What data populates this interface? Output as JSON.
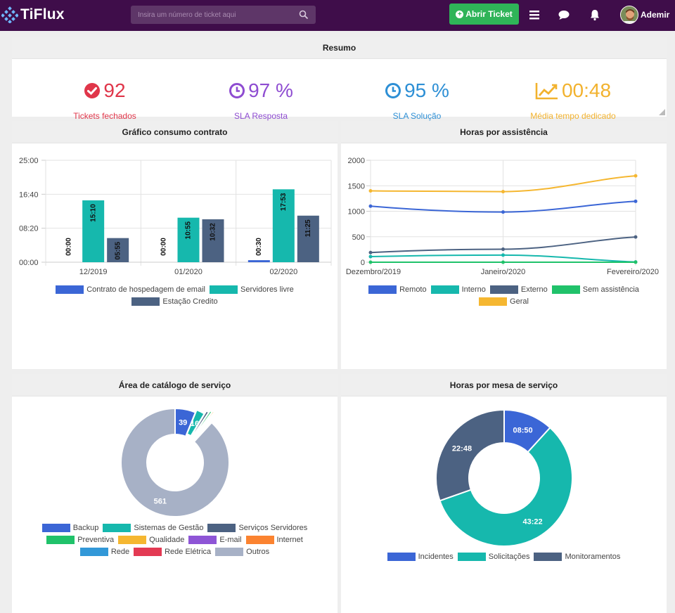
{
  "app": {
    "name": "TiFlux"
  },
  "search": {
    "placeholder": "Insira um número de ticket aqui"
  },
  "toolbar": {
    "new_ticket_label": "Abrir Ticket",
    "user_name": "Ademir"
  },
  "summary": {
    "title": "Resumo",
    "items": [
      {
        "value": "92",
        "label": "Tickets fechados",
        "color": "#e0364a",
        "icon": "check-circle-icon"
      },
      {
        "value": "97 %",
        "label": "SLA Resposta",
        "color": "#8e4cd1",
        "icon": "clock-icon"
      },
      {
        "value": "95 %",
        "label": "SLA Solução",
        "color": "#2d8fd5",
        "icon": "clock-icon"
      },
      {
        "value": "00:48",
        "label": "Média tempo dedicado",
        "color": "#f2b22e",
        "icon": "line-chart-icon"
      }
    ]
  },
  "consumo": {
    "title": "Gráfico consumo contrato",
    "chart_data": {
      "type": "bar",
      "categories": [
        "12/2019",
        "01/2020",
        "02/2020"
      ],
      "yticks": [
        "00:00",
        "08:20",
        "16:40",
        "25:00"
      ],
      "ylim": [
        0,
        25
      ],
      "series": [
        {
          "name": "Contrato de hospedagem de email",
          "color": "#3b66d6",
          "values": [
            0,
            0,
            0.5
          ],
          "labels": [
            "00:00",
            "00:00",
            "00:30"
          ]
        },
        {
          "name": "Servidores livre",
          "color": "#16b8ad",
          "values": [
            15.17,
            10.92,
            17.88
          ],
          "labels": [
            "15:10",
            "10:55",
            "17:53"
          ]
        },
        {
          "name": "Estação Credito",
          "color": "#4c6282",
          "values": [
            5.92,
            10.53,
            11.42
          ],
          "labels": [
            "05:55",
            "10:32",
            "11:25"
          ]
        }
      ]
    }
  },
  "assistencia": {
    "title": "Horas por assistência",
    "chart_data": {
      "type": "line",
      "categories": [
        "Dezembro/2019",
        "Janeiro/2020",
        "Fevereiro/2020"
      ],
      "yticks": [
        "0",
        "500",
        "1000",
        "1500",
        "2000"
      ],
      "ylim": [
        0,
        2000
      ],
      "series": [
        {
          "name": "Remoto",
          "color": "#3b66d6",
          "values": [
            1100,
            985,
            1195
          ]
        },
        {
          "name": "Interno",
          "color": "#16b8ad",
          "values": [
            110,
            140,
            5
          ]
        },
        {
          "name": "Externo",
          "color": "#4c6282",
          "values": [
            190,
            255,
            495
          ]
        },
        {
          "name": "Sem assistência",
          "color": "#20c26a",
          "values": [
            0,
            0,
            0
          ]
        },
        {
          "name": "Geral",
          "color": "#f5b731",
          "values": [
            1400,
            1385,
            1695
          ]
        }
      ]
    }
  },
  "catalogo": {
    "title": "Área de catálogo de serviço",
    "chart_data": {
      "type": "pie",
      "labels": [
        "Backup",
        "Sistemas de Gestão",
        "Serviços Servidores",
        "Preventiva",
        "Qualidade",
        "E-mail",
        "Internet",
        "Rede",
        "Rede Elétrica",
        "Outros"
      ],
      "values": [
        39,
        16,
        5,
        4,
        3,
        2,
        2,
        2,
        2,
        561
      ],
      "value_labels": [
        "39",
        "16",
        "",
        "",
        "",
        "",
        "",
        "",
        "",
        "561"
      ],
      "colors": [
        "#3b66d6",
        "#16b8ad",
        "#4c6282",
        "#20c26a",
        "#f5b731",
        "#8e55d6",
        "#fb8330",
        "#3298d8",
        "#e33a53",
        "#a7b1c6"
      ]
    }
  },
  "mesa": {
    "title": "Horas por mesa de serviço",
    "chart_data": {
      "type": "pie",
      "labels": [
        "Incidentes",
        "Solicitações",
        "Monitoramentos"
      ],
      "values": [
        8.83,
        43.37,
        22.8
      ],
      "value_labels": [
        "08:50",
        "43:22",
        "22:48"
      ],
      "colors": [
        "#3b66d6",
        "#16b8ad",
        "#4c6282"
      ]
    }
  }
}
